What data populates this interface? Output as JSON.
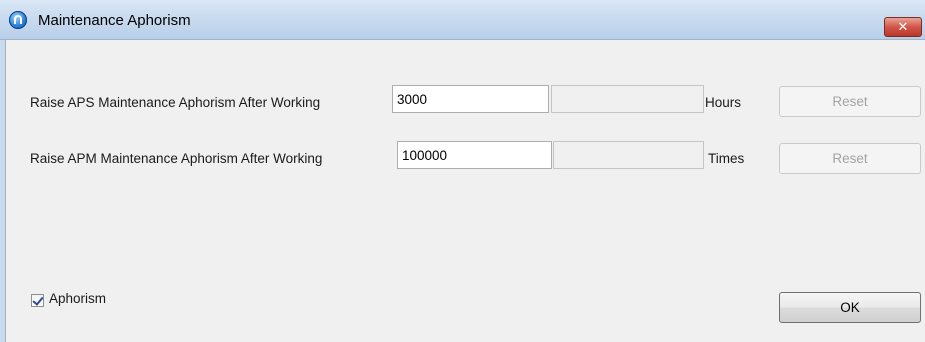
{
  "window": {
    "title": "Maintenance Aphorism",
    "close_glyph": "✕"
  },
  "rows": [
    {
      "label": "Raise APS Maintenance Aphorism After Working",
      "value": "3000",
      "secondary_value": "",
      "unit": "Hours",
      "reset_label": "Reset"
    },
    {
      "label": "Raise APM Maintenance Aphorism After Working",
      "value": "100000",
      "secondary_value": "",
      "unit": "Times",
      "reset_label": "Reset"
    }
  ],
  "aphorism_checkbox": {
    "label": "Aphorism",
    "checked": true
  },
  "ok_label": "OK"
}
